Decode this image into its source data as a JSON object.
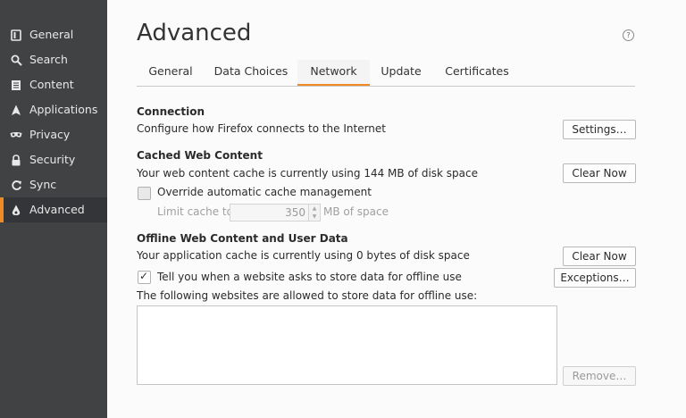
{
  "sidebar": {
    "items": [
      {
        "label": "General",
        "icon": "general-icon"
      },
      {
        "label": "Search",
        "icon": "search-icon"
      },
      {
        "label": "Content",
        "icon": "content-icon"
      },
      {
        "label": "Applications",
        "icon": "applications-icon"
      },
      {
        "label": "Privacy",
        "icon": "privacy-icon"
      },
      {
        "label": "Security",
        "icon": "security-icon"
      },
      {
        "label": "Sync",
        "icon": "sync-icon"
      },
      {
        "label": "Advanced",
        "icon": "advanced-icon",
        "active": true
      }
    ]
  },
  "page": {
    "title": "Advanced",
    "help_glyph": "?"
  },
  "tabs": [
    {
      "label": "General"
    },
    {
      "label": "Data Choices"
    },
    {
      "label": "Network",
      "active": true
    },
    {
      "label": "Update"
    },
    {
      "label": "Certificates"
    }
  ],
  "connection": {
    "heading": "Connection",
    "description": "Configure how Firefox connects to the Internet",
    "settings_button": "Settings…"
  },
  "cache": {
    "heading": "Cached Web Content",
    "description": "Your web content cache is currently using 144 MB of disk space",
    "clear_button": "Clear Now",
    "override_label": "Override automatic cache management",
    "override_checked": false,
    "limit_label": "Limit cache to",
    "limit_value": "350",
    "limit_unit": "MB of space"
  },
  "offline": {
    "heading": "Offline Web Content and User Data",
    "description": "Your application cache is currently using 0 bytes of disk space",
    "clear_button": "Clear Now",
    "tell_label": "Tell you when a website asks to store data for offline use",
    "tell_checked": true,
    "exceptions_button": "Exceptions…",
    "list_label": "The following websites are allowed to store data for offline use:",
    "remove_button": "Remove…"
  },
  "colors": {
    "accent": "#f08a24",
    "sidebar_bg": "#414244",
    "sidebar_active_bg": "#343538",
    "content_bg": "#fbfbfb"
  }
}
